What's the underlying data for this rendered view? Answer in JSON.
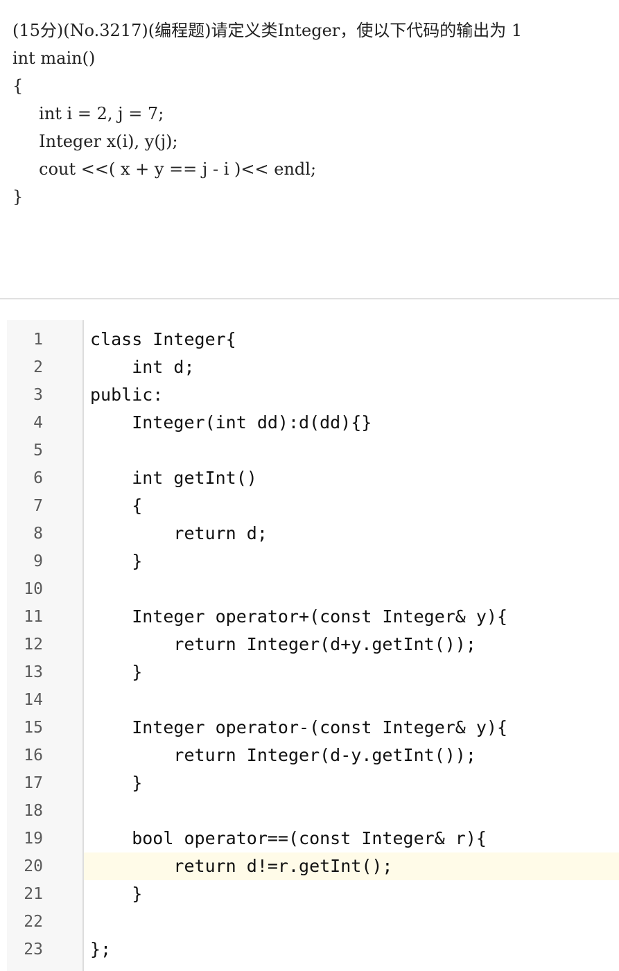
{
  "problem": {
    "lines": [
      "(15分)(No.3217)(编程题)请定义类Integer，使以下代码的输出为 1",
      "int main()",
      "{",
      "     int i = 2, j = 7;",
      "     Integer x(i), y(j);",
      "     cout <<( x + y == j - i )<< endl;",
      "}"
    ]
  },
  "editor": {
    "active_line": 20,
    "lines": [
      {
        "number": "1",
        "code": "class Integer{"
      },
      {
        "number": "2",
        "code": "    int d;"
      },
      {
        "number": "3",
        "code": "public:"
      },
      {
        "number": "4",
        "code": "    Integer(int dd):d(dd){}"
      },
      {
        "number": "5",
        "code": ""
      },
      {
        "number": "6",
        "code": "    int getInt()"
      },
      {
        "number": "7",
        "code": "    {"
      },
      {
        "number": "8",
        "code": "        return d;"
      },
      {
        "number": "9",
        "code": "    }"
      },
      {
        "number": "10",
        "code": ""
      },
      {
        "number": "11",
        "code": "    Integer operator+(const Integer& y){"
      },
      {
        "number": "12",
        "code": "        return Integer(d+y.getInt());"
      },
      {
        "number": "13",
        "code": "    }"
      },
      {
        "number": "14",
        "code": ""
      },
      {
        "number": "15",
        "code": "    Integer operator-(const Integer& y){"
      },
      {
        "number": "16",
        "code": "        return Integer(d-y.getInt());"
      },
      {
        "number": "17",
        "code": "    }"
      },
      {
        "number": "18",
        "code": ""
      },
      {
        "number": "19",
        "code": "    bool operator==(const Integer& r){"
      },
      {
        "number": "20",
        "code": "        return d!=r.getInt();"
      },
      {
        "number": "21",
        "code": "    }"
      },
      {
        "number": "22",
        "code": ""
      },
      {
        "number": "23",
        "code": "};"
      }
    ]
  }
}
